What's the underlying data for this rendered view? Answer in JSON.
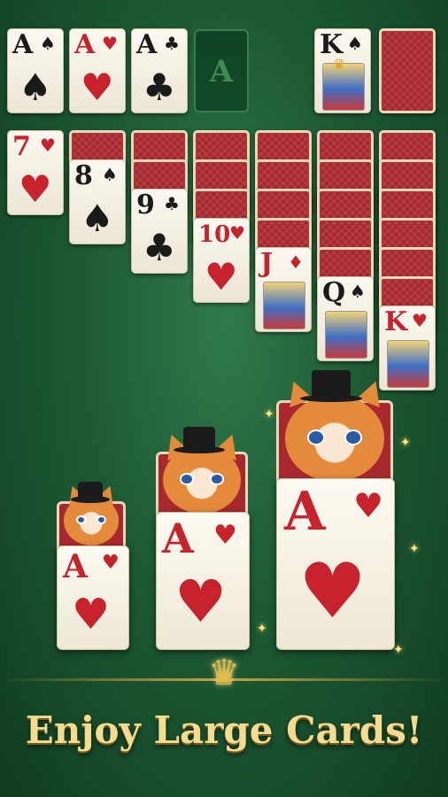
{
  "foundation": [
    {
      "rank": "A",
      "suit": "♠",
      "color": "black"
    },
    {
      "rank": "A",
      "suit": "♥",
      "color": "red"
    },
    {
      "rank": "A",
      "suit": "♣",
      "color": "black"
    },
    {
      "rank": "A",
      "suit": "",
      "color": "slot"
    }
  ],
  "waste": {
    "rank": "K",
    "suit": "♠",
    "color": "black"
  },
  "tableau_faceup": [
    {
      "rank": "7",
      "suit": "♥",
      "color": "red"
    },
    {
      "rank": "8",
      "suit": "♠",
      "color": "black"
    },
    {
      "rank": "9",
      "suit": "♣",
      "color": "black"
    },
    {
      "rank": "10",
      "suit": "♥",
      "color": "red"
    },
    {
      "rank": "J",
      "suit": "♦",
      "color": "red"
    },
    {
      "rank": "Q",
      "suit": "♠",
      "color": "black"
    },
    {
      "rank": "K",
      "suit": "♥",
      "color": "red"
    }
  ],
  "showcase": [
    {
      "rank": "A",
      "suit": "♥"
    },
    {
      "rank": "A",
      "suit": "♥"
    },
    {
      "rank": "A",
      "suit": "♥"
    }
  ],
  "banner": {
    "title": "Enjoy Large Cards!"
  },
  "colors": {
    "felt": "#1d5a34",
    "card_back": "#a8282e",
    "gold": "#f3dc8f",
    "red_suit": "#c8232c"
  }
}
